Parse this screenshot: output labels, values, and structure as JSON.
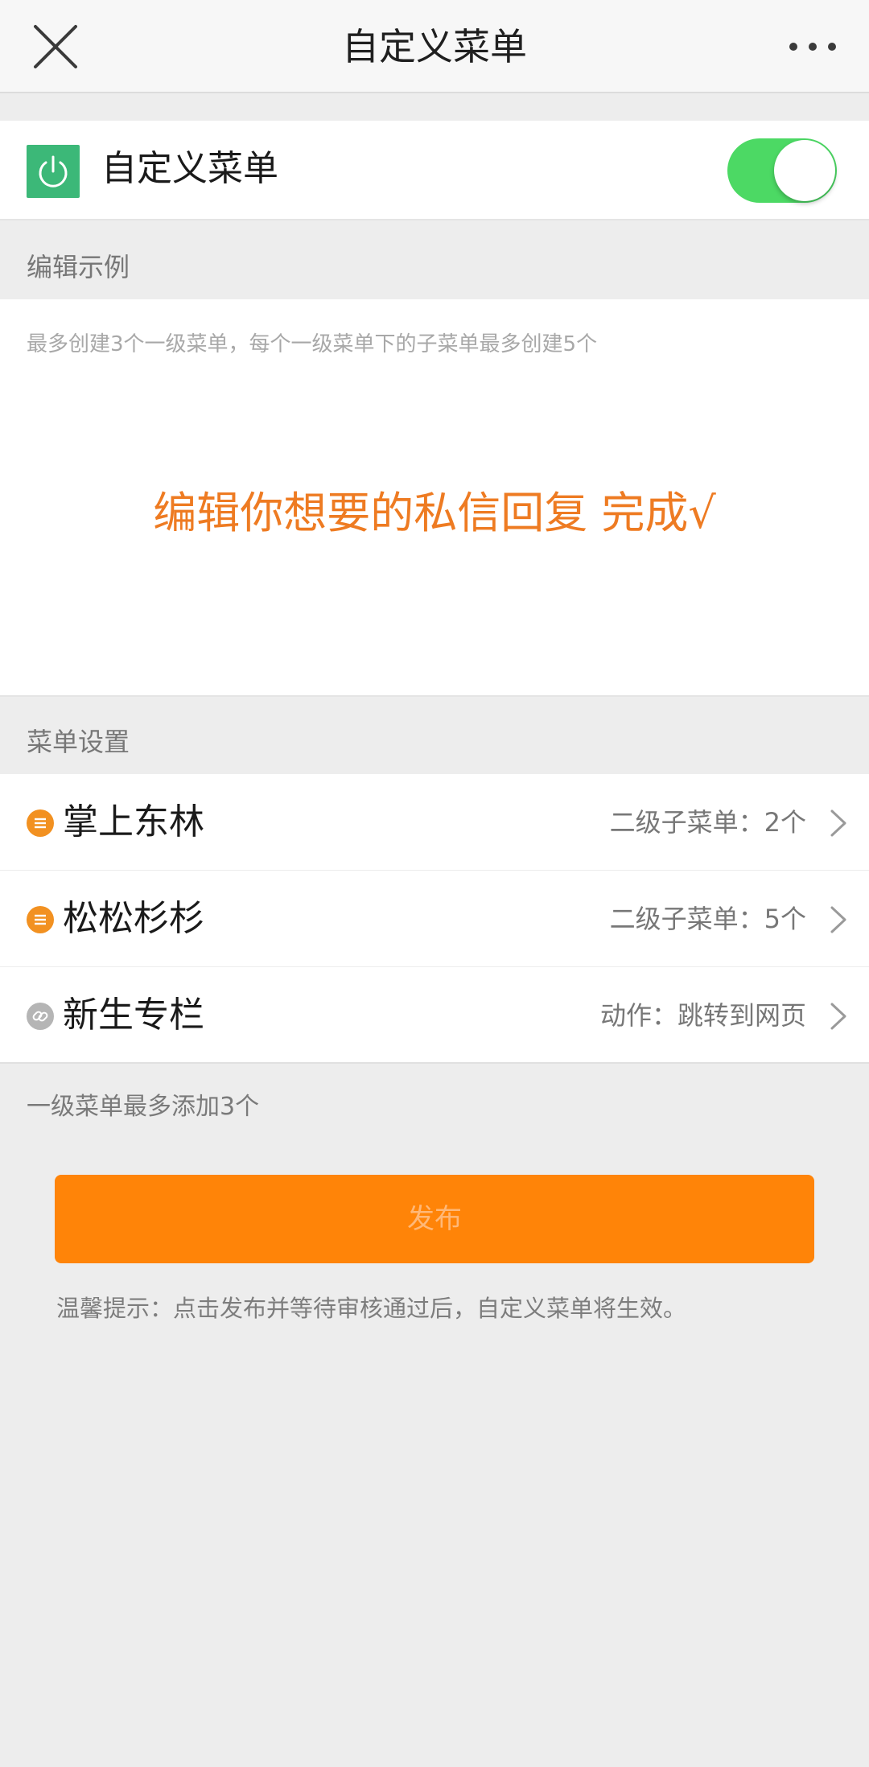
{
  "navbar": {
    "title": "自定义菜单",
    "close_icon": "close-x-icon",
    "more_icon": "more-dots-icon"
  },
  "toggle": {
    "label": "自定义菜单",
    "icon": "power-icon",
    "enabled": true,
    "on_color": "#4cd964"
  },
  "example": {
    "section_title": "编辑示例",
    "hint": "最多创建3个一级菜单，每个一级菜单下的子菜单最多创建5个",
    "headline": "编辑你想要的私信回复 完成√",
    "headline_color": "#ee7b22"
  },
  "menu": {
    "section_title": "菜单设置",
    "items": [
      {
        "name": "掌上东林",
        "detail": "二级子菜单：2个",
        "icon": "submenu-list-icon",
        "icon_color": "#f29121"
      },
      {
        "name": "松松杉杉",
        "detail": "二级子菜单：5个",
        "icon": "submenu-list-icon",
        "icon_color": "#f29121"
      },
      {
        "name": "新生专栏",
        "detail": "动作：跳转到网页",
        "icon": "link-icon",
        "icon_color": "#b5b5b5"
      }
    ],
    "limit_note": "一级菜单最多添加3个"
  },
  "publish": {
    "label": "发布",
    "button_color": "#ff8408",
    "tip": "温馨提示：点击发布并等待审核通过后，自定义菜单将生效。"
  }
}
